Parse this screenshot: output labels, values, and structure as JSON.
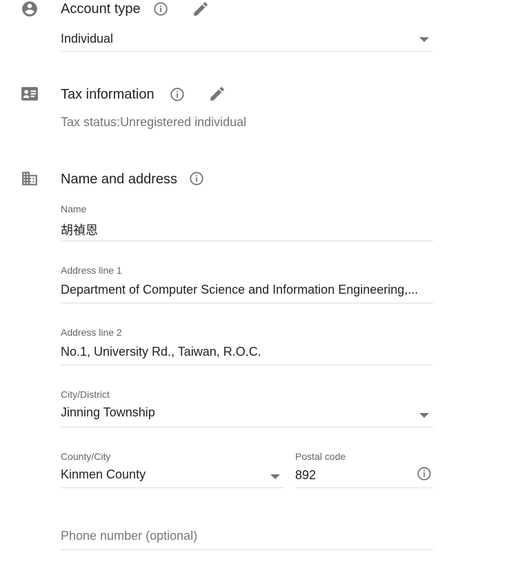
{
  "account_type": {
    "title": "Account type",
    "value": "Individual"
  },
  "tax_information": {
    "title": "Tax information",
    "status_label": "Tax status",
    "status_separator": ":",
    "status_value": "Unregistered individual"
  },
  "name_and_address": {
    "title": "Name and address",
    "name": {
      "label": "Name",
      "value": "胡禎恩"
    },
    "address_line_1": {
      "label": "Address line 1",
      "value": "Department of Computer Science and Information Engineering,..."
    },
    "address_line_2": {
      "label": "Address line 2",
      "value": "No.1, University Rd., Taiwan, R.O.C."
    },
    "city_district": {
      "label": "City/District",
      "value": "Jinning Township"
    },
    "county_city": {
      "label": "County/City",
      "value": "Kinmen County"
    },
    "postal_code": {
      "label": "Postal code",
      "value": "892"
    },
    "phone_number": {
      "placeholder": "Phone number (optional)"
    }
  },
  "colors": {
    "text_primary": "#202124",
    "text_secondary": "#5f6368",
    "icon_gray": "#757575",
    "divider": "#dadce0"
  },
  "icons": [
    "account-circle-icon",
    "info-icon",
    "pencil-icon",
    "id-card-icon",
    "building-icon",
    "dropdown-caret-icon"
  ]
}
